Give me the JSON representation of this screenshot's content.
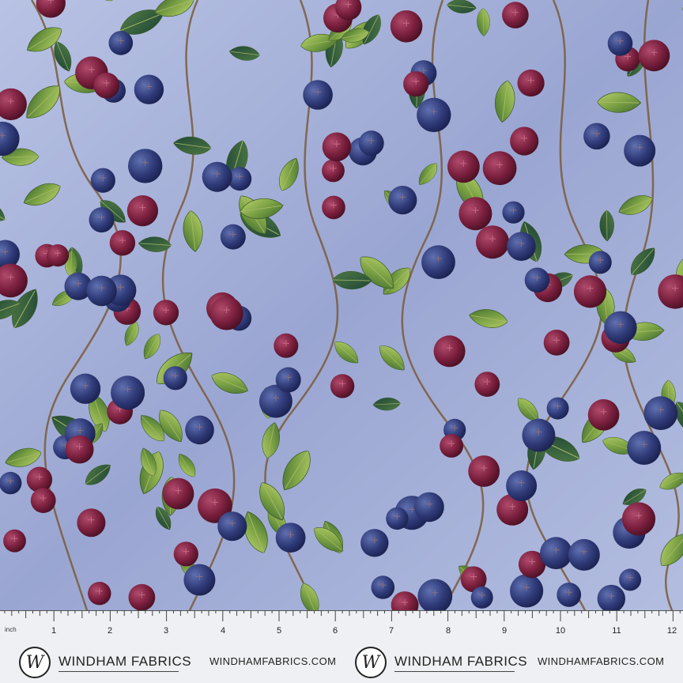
{
  "ruler": {
    "unit": "inch",
    "numbers": [
      "1",
      "2",
      "3",
      "4",
      "5",
      "6",
      "7",
      "8",
      "9",
      "10",
      "11",
      "12"
    ]
  },
  "brand": {
    "name": "WINDHAM FABRICS",
    "url": "WINDHAMFABRICS.COM",
    "logo_letter": "W"
  },
  "colors": {
    "background": "#a9b4d8",
    "leaf": "#6f9b3e",
    "berry_blue": "#34407a",
    "berry_red": "#7a1f3d",
    "ruler_bg": "#eef0f3"
  }
}
